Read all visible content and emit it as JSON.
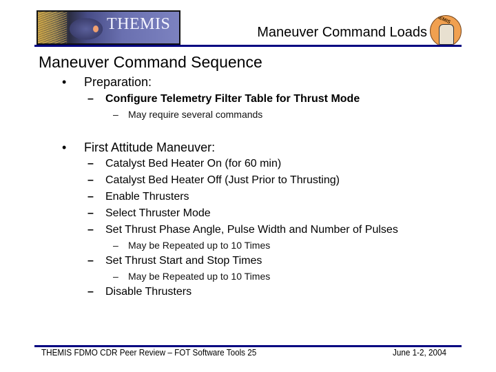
{
  "header": {
    "logo_text": "THEMIS",
    "title": "Maneuver Command Loads",
    "badge_text": "THEMIS"
  },
  "colors": {
    "rule": "#000080",
    "badge": "#f0a050"
  },
  "content": {
    "section_title": "Maneuver Command Sequence",
    "sections": [
      {
        "bullet": "•",
        "label": "Preparation:",
        "items": [
          {
            "bullet": "–",
            "label": "Configure Telemetry Filter Table for Thrust Mode",
            "notes": [
              {
                "bullet": "–",
                "label": "May require several commands"
              }
            ]
          }
        ]
      },
      {
        "bullet": "•",
        "label": "First Attitude Maneuver:",
        "items": [
          {
            "bullet": "–",
            "label": "Catalyst Bed Heater On (for 60 min)"
          },
          {
            "bullet": "–",
            "label": "Catalyst Bed Heater Off (Just Prior to Thrusting)"
          },
          {
            "bullet": "–",
            "label": "Enable Thrusters"
          },
          {
            "bullet": "–",
            "label": "Select Thruster Mode"
          },
          {
            "bullet": "–",
            "label": "Set Thrust Phase Angle, Pulse Width and Number of Pulses",
            "notes": [
              {
                "bullet": "–",
                "label": "May be Repeated up to 10 Times"
              }
            ]
          },
          {
            "bullet": "–",
            "label": "Set Thrust Start and Stop Times",
            "notes": [
              {
                "bullet": "–",
                "label": "May be Repeated up to 10 Times"
              }
            ]
          },
          {
            "bullet": "–",
            "label": "Disable Thrusters"
          }
        ]
      }
    ]
  },
  "footer": {
    "left": "THEMIS FDMO CDR Peer Review – FOT Software Tools 25",
    "right": "June 1-2, 2004"
  }
}
